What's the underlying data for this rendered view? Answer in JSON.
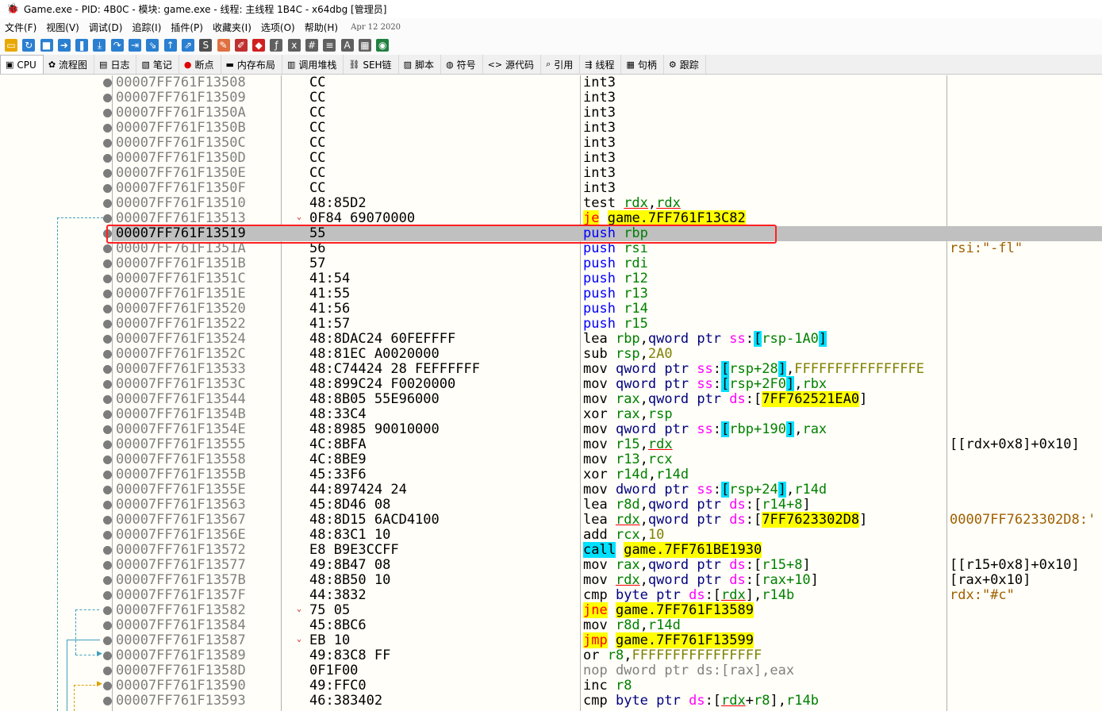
{
  "window": {
    "title": "Game.exe - PID: 4B0C - 模块: game.exe - 线程: 主线程 1B4C - x64dbg [管理员]"
  },
  "menu": {
    "items": [
      "文件(F)",
      "视图(V)",
      "调试(D)",
      "追踪(I)",
      "插件(P)",
      "收藏夹(I)",
      "选项(O)",
      "帮助(H)"
    ],
    "build_date": "Apr 12 2020"
  },
  "toolbar": {
    "icons": [
      "open-icon",
      "restart-icon",
      "stop-icon",
      "run-icon",
      "pause-icon",
      "step-into-icon",
      "step-over-icon",
      "trace-into-icon",
      "trace-over-icon",
      "execute-till-return-icon",
      "run-to-user-code-icon",
      "scylla-icon",
      "patches-icon",
      "comments-icon",
      "labels-icon",
      "bookmarks-icon",
      "functions-icon",
      "variables-icon",
      "hash-icon",
      "font-icon",
      "calculator-icon",
      "help-icon"
    ]
  },
  "tabs": [
    {
      "label": "CPU",
      "icon": "cpu-icon",
      "active": true
    },
    {
      "label": "流程图",
      "icon": "graph-icon"
    },
    {
      "label": "日志",
      "icon": "log-icon"
    },
    {
      "label": "笔记",
      "icon": "notes-icon"
    },
    {
      "label": "断点",
      "icon": "breakpoint-icon"
    },
    {
      "label": "内存布局",
      "icon": "memory-icon"
    },
    {
      "label": "调用堆栈",
      "icon": "callstack-icon"
    },
    {
      "label": "SEH链",
      "icon": "seh-icon"
    },
    {
      "label": "脚本",
      "icon": "script-icon"
    },
    {
      "label": "符号",
      "icon": "symbols-icon"
    },
    {
      "label": "源代码",
      "icon": "source-icon"
    },
    {
      "label": "引用",
      "icon": "references-icon"
    },
    {
      "label": "线程",
      "icon": "threads-icon"
    },
    {
      "label": "句柄",
      "icon": "handles-icon"
    },
    {
      "label": "跟踪",
      "icon": "trace-icon"
    }
  ],
  "disasm": {
    "selected_index": 10,
    "rows": [
      {
        "addr": "00007FF761F13508",
        "bytes": "CC",
        "instr": [
          {
            "t": "int3",
            "c": "t-mn"
          }
        ]
      },
      {
        "addr": "00007FF761F13509",
        "bytes": "CC",
        "instr": [
          {
            "t": "int3",
            "c": "t-mn"
          }
        ]
      },
      {
        "addr": "00007FF761F1350A",
        "bytes": "CC",
        "instr": [
          {
            "t": "int3",
            "c": "t-mn"
          }
        ]
      },
      {
        "addr": "00007FF761F1350B",
        "bytes": "CC",
        "instr": [
          {
            "t": "int3",
            "c": "t-mn"
          }
        ]
      },
      {
        "addr": "00007FF761F1350C",
        "bytes": "CC",
        "instr": [
          {
            "t": "int3",
            "c": "t-mn"
          }
        ]
      },
      {
        "addr": "00007FF761F1350D",
        "bytes": "CC",
        "instr": [
          {
            "t": "int3",
            "c": "t-mn"
          }
        ]
      },
      {
        "addr": "00007FF761F1350E",
        "bytes": "CC",
        "instr": [
          {
            "t": "int3",
            "c": "t-mn"
          }
        ]
      },
      {
        "addr": "00007FF761F1350F",
        "bytes": "CC",
        "instr": [
          {
            "t": "int3",
            "c": "t-mn"
          }
        ]
      },
      {
        "addr": "00007FF761F13510",
        "bytes": "48:85D2",
        "instr": [
          {
            "t": "test ",
            "c": "t-mn"
          },
          {
            "t": "rdx",
            "c": "t-reg ul"
          },
          {
            "t": ",",
            "c": "t-mn"
          },
          {
            "t": "rdx",
            "c": "t-reg ul"
          }
        ]
      },
      {
        "addr": "00007FF761F13513",
        "bytes": "0F84 69070000",
        "arrow": "⌄",
        "instr": [
          {
            "t": "je",
            "c": "hl-y-red"
          },
          {
            "t": " ",
            "c": "t-mn"
          },
          {
            "t": "game.7FF761F13C82",
            "c": "hl-y"
          }
        ]
      },
      {
        "addr": "00007FF761F13519",
        "bytes": "55",
        "instr": [
          {
            "t": "push ",
            "c": "t-push"
          },
          {
            "t": "rbp",
            "c": "t-reg"
          }
        ]
      },
      {
        "addr": "00007FF761F1351A",
        "bytes": "56",
        "instr": [
          {
            "t": "push ",
            "c": "t-push"
          },
          {
            "t": "rsi",
            "c": "t-reg"
          }
        ],
        "comment": "rsi:\"-fl\"",
        "ccls": "c-addr"
      },
      {
        "addr": "00007FF761F1351B",
        "bytes": "57",
        "instr": [
          {
            "t": "push ",
            "c": "t-push"
          },
          {
            "t": "rdi",
            "c": "t-reg"
          }
        ]
      },
      {
        "addr": "00007FF761F1351C",
        "bytes": "41:54",
        "instr": [
          {
            "t": "push ",
            "c": "t-push"
          },
          {
            "t": "r12",
            "c": "t-reg"
          }
        ]
      },
      {
        "addr": "00007FF761F1351E",
        "bytes": "41:55",
        "instr": [
          {
            "t": "push ",
            "c": "t-push"
          },
          {
            "t": "r13",
            "c": "t-reg"
          }
        ]
      },
      {
        "addr": "00007FF761F13520",
        "bytes": "41:56",
        "instr": [
          {
            "t": "push ",
            "c": "t-push"
          },
          {
            "t": "r14",
            "c": "t-reg"
          }
        ]
      },
      {
        "addr": "00007FF761F13522",
        "bytes": "41:57",
        "instr": [
          {
            "t": "push ",
            "c": "t-push"
          },
          {
            "t": "r15",
            "c": "t-reg"
          }
        ]
      },
      {
        "addr": "00007FF761F13524",
        "bytes": "48:8DAC24 60FEFFFF",
        "instr": [
          {
            "t": "lea ",
            "c": "t-mn"
          },
          {
            "t": "rbp",
            "c": "t-reg"
          },
          {
            "t": ",",
            "c": "t-mn"
          },
          {
            "t": "qword ptr ",
            "c": "t-size"
          },
          {
            "t": "ss",
            "c": "t-seg"
          },
          {
            "t": ":",
            "c": "t-mn"
          },
          {
            "t": "[",
            "c": "hl-c"
          },
          {
            "t": "rsp-1A0",
            "c": "t-reg"
          },
          {
            "t": "]",
            "c": "hl-c"
          }
        ]
      },
      {
        "addr": "00007FF761F1352C",
        "bytes": "48:81EC A0020000",
        "instr": [
          {
            "t": "sub ",
            "c": "t-mn"
          },
          {
            "t": "rsp",
            "c": "t-reg"
          },
          {
            "t": ",",
            "c": "t-mn"
          },
          {
            "t": "2A0",
            "c": "t-imm"
          }
        ]
      },
      {
        "addr": "00007FF761F13533",
        "bytes": "48:C74424 28 FEFFFFFF",
        "instr": [
          {
            "t": "mov ",
            "c": "t-mn"
          },
          {
            "t": "qword ptr ",
            "c": "t-size"
          },
          {
            "t": "ss",
            "c": "t-seg"
          },
          {
            "t": ":",
            "c": "t-mn"
          },
          {
            "t": "[",
            "c": "hl-c"
          },
          {
            "t": "rsp+28",
            "c": "t-reg"
          },
          {
            "t": "]",
            "c": "hl-c"
          },
          {
            "t": ",",
            "c": "t-mn"
          },
          {
            "t": "FFFFFFFFFFFFFFFE",
            "c": "t-imm"
          }
        ]
      },
      {
        "addr": "00007FF761F1353C",
        "bytes": "48:899C24 F0020000",
        "instr": [
          {
            "t": "mov ",
            "c": "t-mn"
          },
          {
            "t": "qword ptr ",
            "c": "t-size"
          },
          {
            "t": "ss",
            "c": "t-seg"
          },
          {
            "t": ":",
            "c": "t-mn"
          },
          {
            "t": "[",
            "c": "hl-c"
          },
          {
            "t": "rsp+2F0",
            "c": "t-reg"
          },
          {
            "t": "]",
            "c": "hl-c"
          },
          {
            "t": ",",
            "c": "t-mn"
          },
          {
            "t": "rbx",
            "c": "t-reg"
          }
        ]
      },
      {
        "addr": "00007FF761F13544",
        "bytes": "48:8B05 55E96000",
        "instr": [
          {
            "t": "mov ",
            "c": "t-mn"
          },
          {
            "t": "rax",
            "c": "t-reg"
          },
          {
            "t": ",",
            "c": "t-mn"
          },
          {
            "t": "qword ptr ",
            "c": "t-size"
          },
          {
            "t": "ds",
            "c": "t-seg"
          },
          {
            "t": ":[",
            "c": "t-mn"
          },
          {
            "t": "7FF762521EA0",
            "c": "hl-y"
          },
          {
            "t": "]",
            "c": "t-mn"
          }
        ]
      },
      {
        "addr": "00007FF761F1354B",
        "bytes": "48:33C4",
        "instr": [
          {
            "t": "xor ",
            "c": "t-mn"
          },
          {
            "t": "rax",
            "c": "t-reg"
          },
          {
            "t": ",",
            "c": "t-mn"
          },
          {
            "t": "rsp",
            "c": "t-reg"
          }
        ]
      },
      {
        "addr": "00007FF761F1354E",
        "bytes": "48:8985 90010000",
        "instr": [
          {
            "t": "mov ",
            "c": "t-mn"
          },
          {
            "t": "qword ptr ",
            "c": "t-size"
          },
          {
            "t": "ss",
            "c": "t-seg"
          },
          {
            "t": ":",
            "c": "t-mn"
          },
          {
            "t": "[",
            "c": "hl-c"
          },
          {
            "t": "rbp+190",
            "c": "t-reg"
          },
          {
            "t": "]",
            "c": "hl-c"
          },
          {
            "t": ",",
            "c": "t-mn"
          },
          {
            "t": "rax",
            "c": "t-reg"
          }
        ]
      },
      {
        "addr": "00007FF761F13555",
        "bytes": "4C:8BFA",
        "instr": [
          {
            "t": "mov ",
            "c": "t-mn"
          },
          {
            "t": "r15",
            "c": "t-reg"
          },
          {
            "t": ",",
            "c": "t-mn"
          },
          {
            "t": "rdx",
            "c": "t-reg ul"
          }
        ],
        "comment": "[[rdx+0x8]+0x10]"
      },
      {
        "addr": "00007FF761F13558",
        "bytes": "4C:8BE9",
        "instr": [
          {
            "t": "mov ",
            "c": "t-mn"
          },
          {
            "t": "r13",
            "c": "t-reg"
          },
          {
            "t": ",",
            "c": "t-mn"
          },
          {
            "t": "rcx",
            "c": "t-reg"
          }
        ]
      },
      {
        "addr": "00007FF761F1355B",
        "bytes": "45:33F6",
        "instr": [
          {
            "t": "xor ",
            "c": "t-mn"
          },
          {
            "t": "r14d",
            "c": "t-reg"
          },
          {
            "t": ",",
            "c": "t-mn"
          },
          {
            "t": "r14d",
            "c": "t-reg"
          }
        ]
      },
      {
        "addr": "00007FF761F1355E",
        "bytes": "44:897424 24",
        "instr": [
          {
            "t": "mov ",
            "c": "t-mn"
          },
          {
            "t": "dword ptr ",
            "c": "t-size"
          },
          {
            "t": "ss",
            "c": "t-seg"
          },
          {
            "t": ":",
            "c": "t-mn"
          },
          {
            "t": "[",
            "c": "hl-c"
          },
          {
            "t": "rsp+24",
            "c": "t-reg"
          },
          {
            "t": "]",
            "c": "hl-c"
          },
          {
            "t": ",",
            "c": "t-mn"
          },
          {
            "t": "r14d",
            "c": "t-reg"
          }
        ]
      },
      {
        "addr": "00007FF761F13563",
        "bytes": "45:8D46 08",
        "instr": [
          {
            "t": "lea ",
            "c": "t-mn"
          },
          {
            "t": "r8d",
            "c": "t-reg"
          },
          {
            "t": ",",
            "c": "t-mn"
          },
          {
            "t": "qword ptr ",
            "c": "t-size"
          },
          {
            "t": "ds",
            "c": "t-seg"
          },
          {
            "t": ":[",
            "c": "t-mn"
          },
          {
            "t": "r14+8",
            "c": "t-reg"
          },
          {
            "t": "]",
            "c": "t-mn"
          }
        ]
      },
      {
        "addr": "00007FF761F13567",
        "bytes": "48:8D15 6ACD4100",
        "instr": [
          {
            "t": "lea ",
            "c": "t-mn"
          },
          {
            "t": "rdx",
            "c": "t-reg ul"
          },
          {
            "t": ",",
            "c": "t-mn"
          },
          {
            "t": "qword ptr ",
            "c": "t-size"
          },
          {
            "t": "ds",
            "c": "t-seg"
          },
          {
            "t": ":[",
            "c": "t-mn"
          },
          {
            "t": "7FF7623302D8",
            "c": "hl-y"
          },
          {
            "t": "]",
            "c": "t-mn"
          }
        ],
        "comment": "00007FF7623302D8:'",
        "ccls": "c-addr"
      },
      {
        "addr": "00007FF761F1356E",
        "bytes": "48:83C1 10",
        "instr": [
          {
            "t": "add ",
            "c": "t-mn"
          },
          {
            "t": "rcx",
            "c": "t-reg"
          },
          {
            "t": ",",
            "c": "t-mn"
          },
          {
            "t": "10",
            "c": "t-imm"
          }
        ]
      },
      {
        "addr": "00007FF761F13572",
        "bytes": "E8 B9E3CCFF",
        "instr": [
          {
            "t": "call",
            "c": "hl-c"
          },
          {
            "t": " ",
            "c": "t-mn"
          },
          {
            "t": "game.7FF761BE1930",
            "c": "hl-y"
          }
        ]
      },
      {
        "addr": "00007FF761F13577",
        "bytes": "49:8B47 08",
        "instr": [
          {
            "t": "mov ",
            "c": "t-mn"
          },
          {
            "t": "rax",
            "c": "t-reg"
          },
          {
            "t": ",",
            "c": "t-mn"
          },
          {
            "t": "qword ptr ",
            "c": "t-size"
          },
          {
            "t": "ds",
            "c": "t-seg"
          },
          {
            "t": ":[",
            "c": "t-mn"
          },
          {
            "t": "r15+8",
            "c": "t-reg"
          },
          {
            "t": "]",
            "c": "t-mn"
          }
        ],
        "comment": "[[r15+0x8]+0x10]"
      },
      {
        "addr": "00007FF761F1357B",
        "bytes": "48:8B50 10",
        "instr": [
          {
            "t": "mov ",
            "c": "t-mn"
          },
          {
            "t": "rdx",
            "c": "t-reg ul"
          },
          {
            "t": ",",
            "c": "t-mn"
          },
          {
            "t": "qword ptr ",
            "c": "t-size"
          },
          {
            "t": "ds",
            "c": "t-seg"
          },
          {
            "t": ":[",
            "c": "t-mn"
          },
          {
            "t": "rax+10",
            "c": "t-reg"
          },
          {
            "t": "]",
            "c": "t-mn"
          }
        ],
        "comment": "[rax+0x10]"
      },
      {
        "addr": "00007FF761F1357F",
        "bytes": "44:3832",
        "instr": [
          {
            "t": "cmp ",
            "c": "t-mn"
          },
          {
            "t": "byte ptr ",
            "c": "t-size"
          },
          {
            "t": "ds",
            "c": "t-seg"
          },
          {
            "t": ":[",
            "c": "t-mn"
          },
          {
            "t": "rdx",
            "c": "t-reg ul"
          },
          {
            "t": "],",
            "c": "t-mn"
          },
          {
            "t": "r14b",
            "c": "t-reg"
          }
        ],
        "comment": "rdx:\"#c\"",
        "ccls": "c-addr"
      },
      {
        "addr": "00007FF761F13582",
        "bytes": "75 05",
        "arrow": "⌄",
        "instr": [
          {
            "t": "jne",
            "c": "hl-y-red"
          },
          {
            "t": " ",
            "c": "t-mn"
          },
          {
            "t": "game.7FF761F13589",
            "c": "hl-y"
          }
        ]
      },
      {
        "addr": "00007FF761F13584",
        "bytes": "45:8BC6",
        "instr": [
          {
            "t": "mov ",
            "c": "t-mn"
          },
          {
            "t": "r8d",
            "c": "t-reg"
          },
          {
            "t": ",",
            "c": "t-mn"
          },
          {
            "t": "r14d",
            "c": "t-reg"
          }
        ]
      },
      {
        "addr": "00007FF761F13587",
        "bytes": "EB 10",
        "arrow": "⌄",
        "instr": [
          {
            "t": "jmp",
            "c": "hl-y-red"
          },
          {
            "t": " ",
            "c": "t-mn"
          },
          {
            "t": "game.7FF761F13599",
            "c": "hl-y"
          }
        ]
      },
      {
        "addr": "00007FF761F13589",
        "bytes": "49:83C8 FF",
        "instr": [
          {
            "t": "or ",
            "c": "t-mn"
          },
          {
            "t": "r8",
            "c": "t-reg"
          },
          {
            "t": ",",
            "c": "t-mn"
          },
          {
            "t": "FFFFFFFFFFFFFFFF",
            "c": "t-imm"
          }
        ]
      },
      {
        "addr": "00007FF761F1358D",
        "bytes": "0F1F00",
        "instr": [
          {
            "t": "nop dword ptr ds:[rax],eax",
            "c": "t-grey"
          }
        ]
      },
      {
        "addr": "00007FF761F13590",
        "bytes": "49:FFC0",
        "instr": [
          {
            "t": "inc ",
            "c": "t-mn"
          },
          {
            "t": "r8",
            "c": "t-reg"
          }
        ]
      },
      {
        "addr": "00007FF761F13593",
        "bytes": "46:383402",
        "instr": [
          {
            "t": "cmp ",
            "c": "t-mn"
          },
          {
            "t": "byte ptr ",
            "c": "t-size"
          },
          {
            "t": "ds",
            "c": "t-seg"
          },
          {
            "t": ":[",
            "c": "t-mn"
          },
          {
            "t": "rdx",
            "c": "t-reg ul"
          },
          {
            "t": "+",
            "c": "t-mn"
          },
          {
            "t": "r8",
            "c": "t-reg"
          },
          {
            "t": "],",
            "c": "t-mn"
          },
          {
            "t": "r14b",
            "c": "t-reg"
          }
        ]
      }
    ]
  }
}
